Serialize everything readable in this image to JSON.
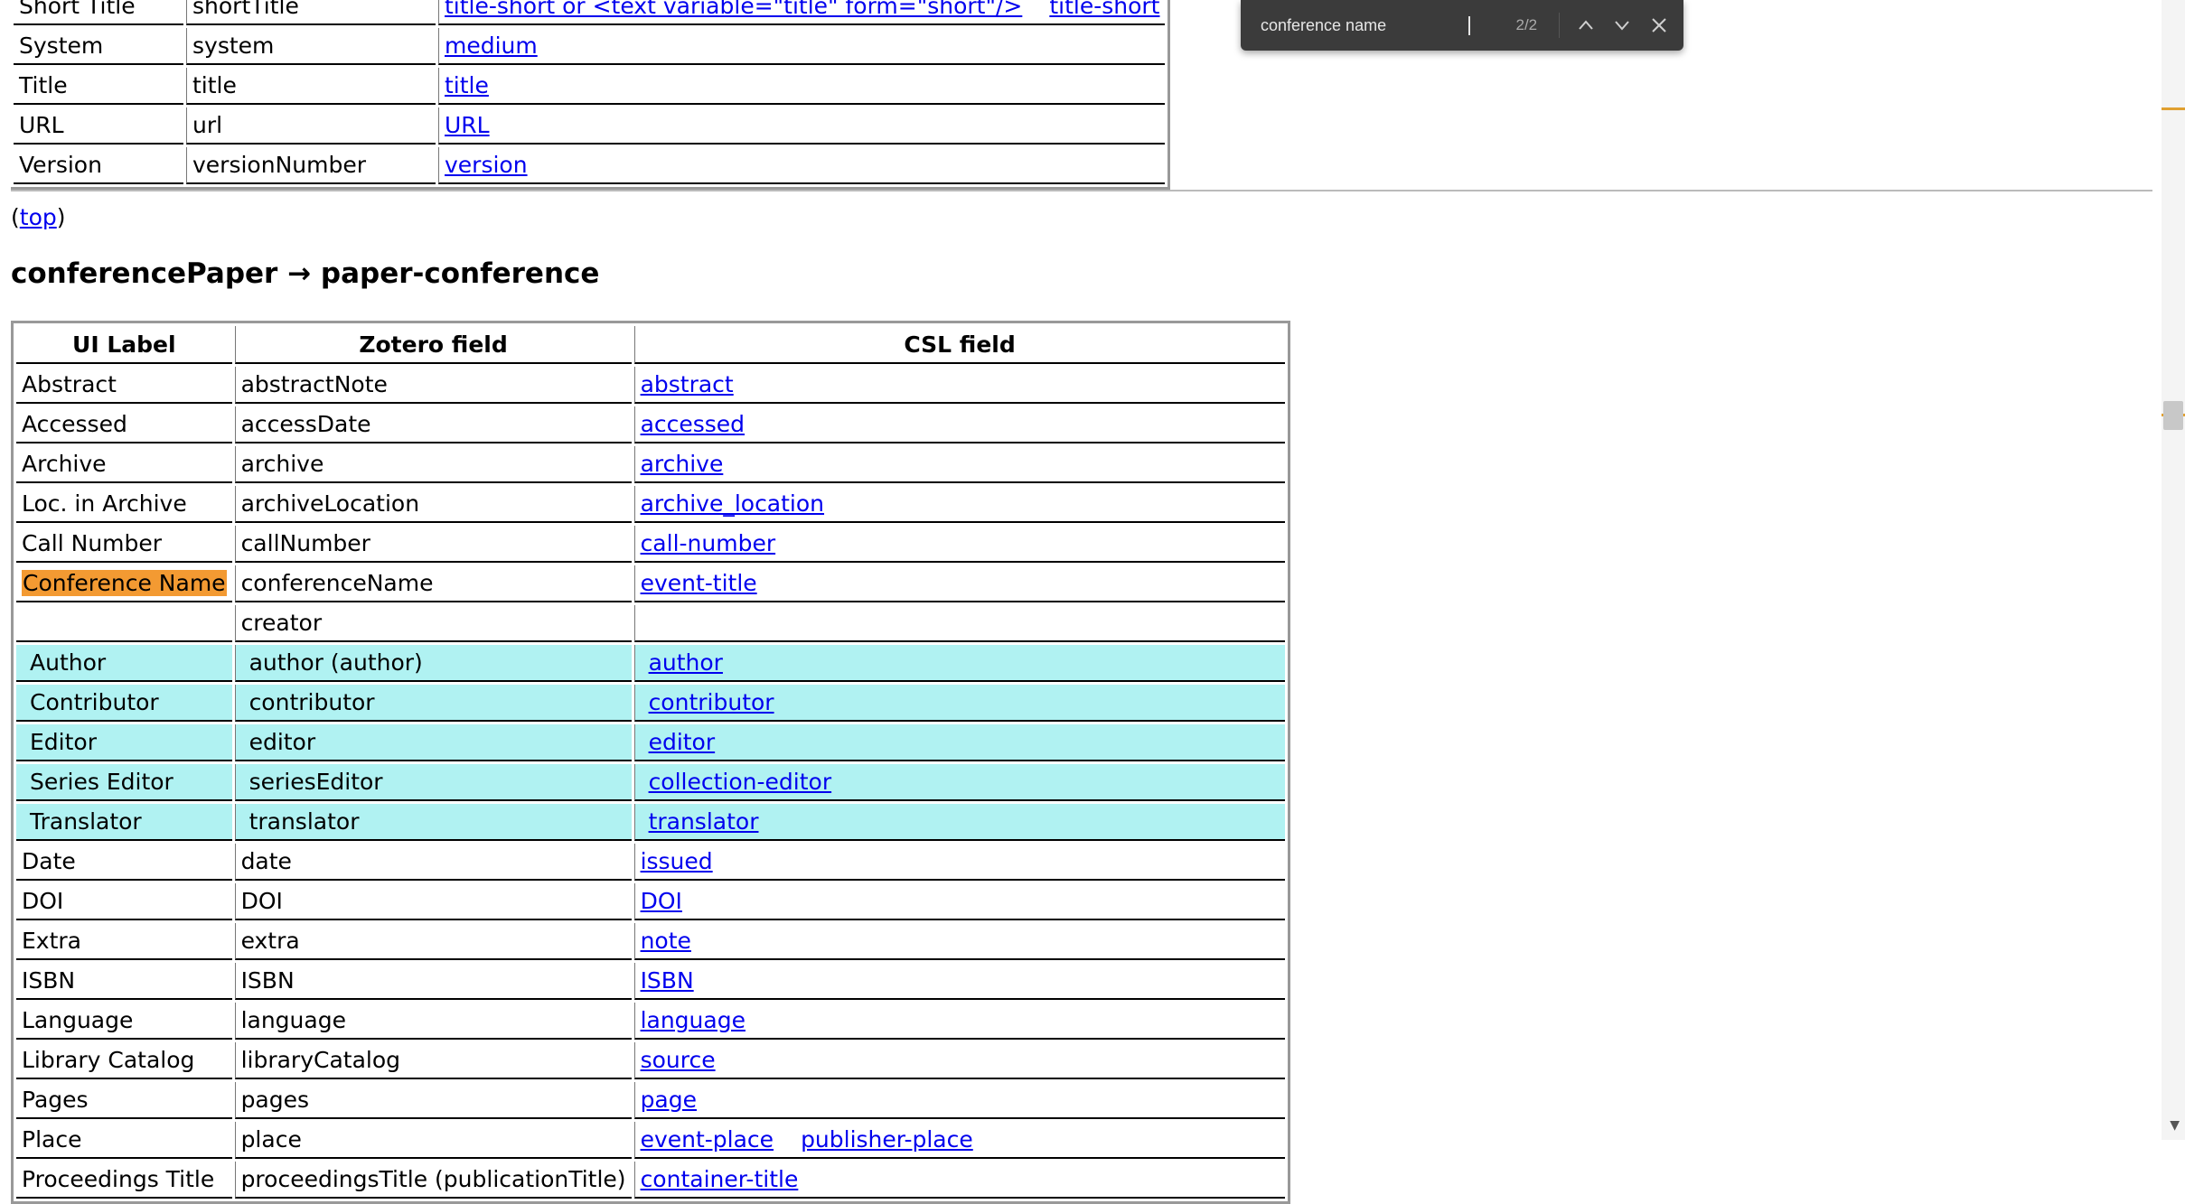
{
  "find_bar": {
    "query": "conference name",
    "count": "2/2"
  },
  "top_table": {
    "rows": [
      {
        "label": "Short Title",
        "zotero": "shortTitle",
        "csl": [
          "title-short or <text variable=\"title\" form=\"short\"/>",
          "title-short"
        ]
      },
      {
        "label": "System",
        "zotero": "system",
        "csl": [
          "medium"
        ]
      },
      {
        "label": "Title",
        "zotero": "title",
        "csl": [
          "title"
        ]
      },
      {
        "label": "URL",
        "zotero": "url",
        "csl": [
          "URL"
        ]
      },
      {
        "label": "Version",
        "zotero": "versionNumber",
        "csl": [
          "version"
        ]
      }
    ]
  },
  "top_link": {
    "open": "(",
    "text": "top",
    "close": ")"
  },
  "section": {
    "title": "conferencePaper → paper-conference"
  },
  "main_table": {
    "headers": [
      "UI Label",
      "Zotero field",
      "CSL field"
    ],
    "rows": [
      {
        "label": "Abstract",
        "zotero": "abstractNote",
        "csl": [
          "abstract"
        ]
      },
      {
        "label": "Accessed",
        "zotero": "accessDate",
        "csl": [
          "accessed"
        ]
      },
      {
        "label": "Archive",
        "zotero": "archive",
        "csl": [
          "archive"
        ]
      },
      {
        "label": "Loc. in Archive",
        "zotero": "archiveLocation",
        "csl": [
          "archive_location"
        ]
      },
      {
        "label": "Call Number",
        "zotero": "callNumber",
        "csl": [
          "call-number"
        ]
      },
      {
        "label": "Conference Name",
        "zotero": "conferenceName",
        "csl": [
          "event-title"
        ],
        "highlight": true
      },
      {
        "label": "",
        "zotero": "creator",
        "csl": []
      },
      {
        "label": "Author",
        "zotero": "author (author)",
        "csl": [
          "author"
        ],
        "sub": true
      },
      {
        "label": "Contributor",
        "zotero": "contributor",
        "csl": [
          "contributor"
        ],
        "sub": true
      },
      {
        "label": "Editor",
        "zotero": "editor",
        "csl": [
          "editor"
        ],
        "sub": true
      },
      {
        "label": "Series Editor",
        "zotero": "seriesEditor",
        "csl": [
          "collection-editor"
        ],
        "sub": true
      },
      {
        "label": "Translator",
        "zotero": "translator",
        "csl": [
          "translator"
        ],
        "sub": true
      },
      {
        "label": "Date",
        "zotero": "date",
        "csl": [
          "issued"
        ]
      },
      {
        "label": "DOI",
        "zotero": "DOI",
        "csl": [
          "DOI"
        ]
      },
      {
        "label": "Extra",
        "zotero": "extra",
        "csl": [
          "note"
        ]
      },
      {
        "label": "ISBN",
        "zotero": "ISBN",
        "csl": [
          "ISBN"
        ]
      },
      {
        "label": "Language",
        "zotero": "language",
        "csl": [
          "language"
        ]
      },
      {
        "label": "Library Catalog",
        "zotero": "libraryCatalog",
        "csl": [
          "source"
        ]
      },
      {
        "label": "Pages",
        "zotero": "pages",
        "csl": [
          "page"
        ]
      },
      {
        "label": "Place",
        "zotero": "place",
        "csl": [
          "event-place",
          "publisher-place"
        ]
      },
      {
        "label": "Proceedings Title",
        "zotero": "proceedingsTitle (publicationTitle)",
        "csl": [
          "container-title"
        ]
      }
    ]
  },
  "icons": {
    "prev": "chevron-up-icon",
    "next": "chevron-down-icon",
    "close": "close-icon",
    "scroll_down": "scroll-down-arrow-icon"
  },
  "colors": {
    "find_highlight": "#f39a32",
    "creator_rows": "#b0f2f2",
    "find_bar_bg": "#3b3b3b",
    "link": "#0000ee"
  }
}
